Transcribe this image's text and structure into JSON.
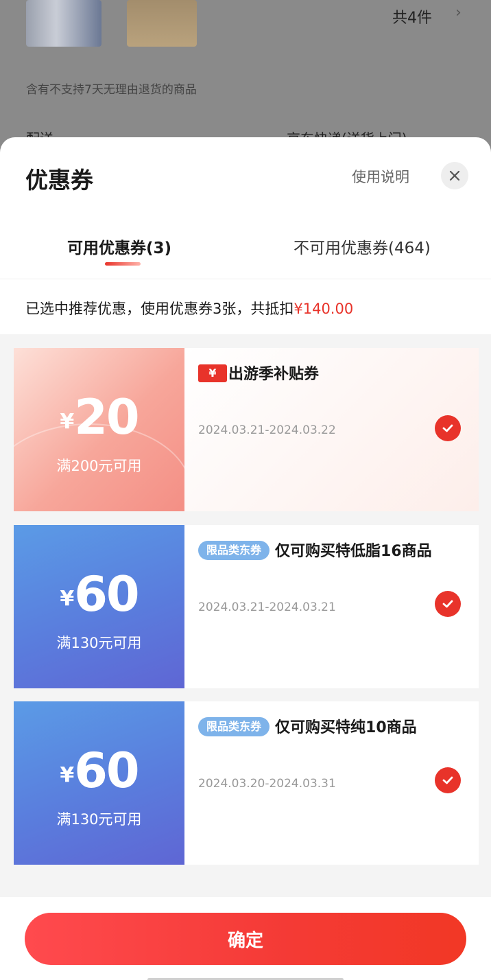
{
  "background": {
    "item_count": "共4件",
    "return_note": "含有不支持7天无理由退货的商品",
    "delivery_label": "配送",
    "delivery_value": "京东快递(送货上门)"
  },
  "sheet": {
    "title": "优惠券",
    "help_link": "使用说明",
    "close_icon": "close-icon"
  },
  "tabs": [
    {
      "label": "可用优惠券(3)",
      "active": true
    },
    {
      "label": "不可用优惠券(464)",
      "active": false
    }
  ],
  "summary": {
    "text": "已选中推荐优惠，使用优惠券3张，共抵扣",
    "amount": "¥140.00"
  },
  "coupons": [
    {
      "yen": "¥",
      "amount": "20",
      "condition": "满200元可用",
      "badge": "¥",
      "title": "出游季补贴券",
      "date": "2024.03.21-2024.03.22",
      "selected": true
    },
    {
      "yen": "¥",
      "amount": "60",
      "condition": "满130元可用",
      "tag": "限品类东券",
      "title": "仅可购买特低脂16商品",
      "date": "2024.03.21-2024.03.21",
      "selected": true
    },
    {
      "yen": "¥",
      "amount": "60",
      "condition": "满130元可用",
      "tag": "限品类东券",
      "title": "仅可购买特纯10商品",
      "date": "2024.03.20-2024.03.31",
      "selected": true
    }
  ],
  "footer": {
    "confirm_label": "确定"
  },
  "colors": {
    "accent_red": "#e8332a",
    "coupon_blue": "#5a7ddd",
    "coupon_pink": "#f7a69a"
  }
}
